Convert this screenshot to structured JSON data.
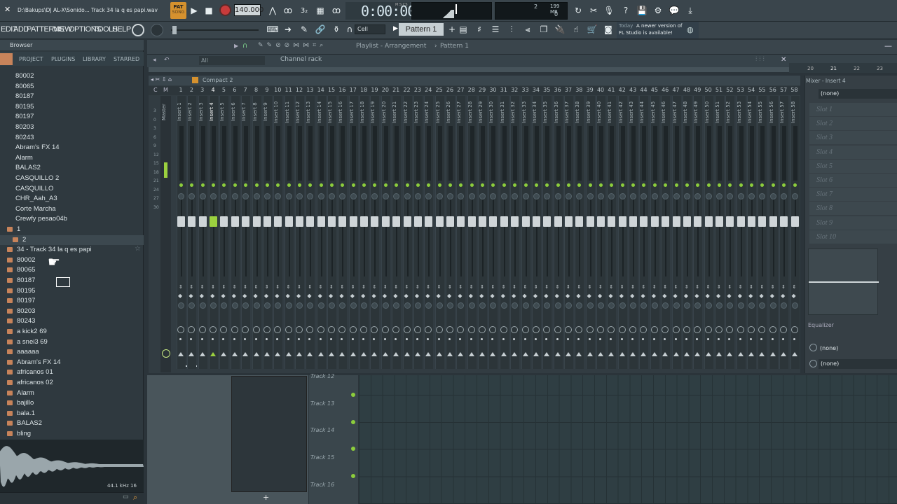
{
  "titlebar": {
    "path": "D:\\Bakups\\DJ AL-X\\Sonido... Track 34 la q es papi.wav",
    "pat": "PAT",
    "song": "SONG"
  },
  "transport": {
    "tempo": "140.000",
    "time": "0:00:00",
    "time_label": "M:S:CS",
    "cpu": "2",
    "memory": "199 MB",
    "poly": "0"
  },
  "menu": [
    "EDIT",
    "ADD",
    "PATTERNS",
    "VIEW",
    "OPTIONS",
    "TOOLS",
    "HELP"
  ],
  "toolbar": {
    "snap": "Cell",
    "pattern": "Pattern 1"
  },
  "news": {
    "line1_prefix": "Today",
    "line1": "A newer version of",
    "line2": "FL Studio is available!"
  },
  "browser": {
    "title": "Browser",
    "tabs": [
      "ALL",
      "PROJECT",
      "PLUGINS",
      "LIBRARY",
      "STARRED"
    ],
    "items": [
      "80002",
      "80065",
      "80187",
      "80195",
      "80197",
      "80203",
      "80243",
      "Abram's FX 14",
      "Alarm",
      "BALAS2",
      "CASQUILLO 2",
      "CASQUILLO",
      "CHR_Aah_A3",
      "Corte Marcha",
      "Crewfy pesao04b",
      "1",
      "2",
      "34 - Track 34 la q es papi",
      "80002",
      "80065",
      "80187",
      "80195",
      "80197",
      "80203",
      "80243",
      "a kick2 69",
      "a snei3 69",
      "aaaaaa",
      "Abram's FX 14",
      "africanos 01",
      "africanos 02",
      "Alarm",
      "bajillo",
      "bala.1",
      "BALAS2",
      "bling"
    ],
    "wave_info": "44.1 kHz 16"
  },
  "playlist": {
    "title": "Playlist - Arrangement",
    "sep": "›",
    "pattern": "Pattern 1"
  },
  "channel_rack": {
    "title": "Channel rack",
    "filter": "All"
  },
  "mixer": {
    "preset": "Compact 2",
    "title": "Mixer - Insert 4",
    "master_label": "Master",
    "strip_labels": [
      "Insert 1",
      "Insert 2",
      "Insert 3",
      "Insert 4",
      "Insert 5",
      "Insert 6",
      "Insert 7",
      "Insert 8",
      "Insert 9",
      "Insert 10",
      "Insert 11",
      "Insert 12",
      "Insert 13",
      "Insert 14",
      "Insert 15",
      "Insert 16",
      "Insert 17",
      "Insert 18",
      "Insert 19",
      "Insert 20",
      "Insert 21",
      "Insert 22",
      "Insert 23",
      "Insert 24",
      "Insert 25",
      "Insert 26",
      "Insert 27",
      "Insert 28",
      "Insert 29",
      "Insert 30",
      "Insert 31",
      "Insert 32",
      "Insert 33",
      "Insert 34",
      "Insert 35",
      "Insert 36",
      "Insert 37",
      "Insert 38",
      "Insert 39",
      "Insert 40",
      "Insert 41",
      "Insert 42",
      "Insert 43",
      "Insert 44",
      "Insert 45",
      "Insert 46",
      "Insert 47",
      "Insert 48",
      "Insert 49",
      "Insert 50",
      "Insert 51",
      "Insert 52",
      "Insert 53",
      "Insert 54",
      "Insert 55",
      "Insert 56",
      "Insert 57",
      "Insert 58"
    ],
    "input": "(none)",
    "output": "(none)",
    "output2": "(none)",
    "eq": "Equalizer",
    "slots": [
      "Slot 1",
      "Slot 2",
      "Slot 3",
      "Slot 4",
      "Slot 5",
      "Slot 6",
      "Slot 7",
      "Slot 8",
      "Slot 9",
      "Slot 10"
    ],
    "db_scale": [
      "3",
      "0",
      "3",
      "6",
      "9",
      "12",
      "15",
      "18",
      "21",
      "24",
      "27",
      "30"
    ]
  },
  "ruler": [
    "20",
    "21",
    "22",
    "23"
  ],
  "tracks": [
    "Track 12",
    "Track 13",
    "Track 14",
    "Track 15",
    "Track 16"
  ]
}
